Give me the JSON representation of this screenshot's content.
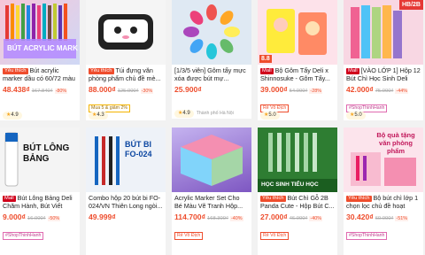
{
  "products": [
    {
      "img_text": "BÚT ACRYLIC MARK",
      "tag": "Yêu thích",
      "title": "Bút acrylic marker dầu có 60/72 màu hộp c...",
      "price": "48.438₫",
      "old": "167.840₫",
      "disc": "-80%",
      "chips": [],
      "rating": "4.9",
      "loc": ""
    },
    {
      "img_text": "",
      "tag": "Yêu thích",
      "title": "Túi đựng văn phòng phẩm chủ đề mè...",
      "price": "88.000₫",
      "old": "125.000₫",
      "disc": "-30%",
      "chips": [
        "Mua 5 & giảm 2%"
      ],
      "rating": "4.3",
      "loc": ""
    },
    {
      "img_text": "",
      "tag": "",
      "title": "[1/3/5 viên] Gôm tẩy mực xóa được bút mự...",
      "price": "25.900₫",
      "old": "",
      "disc": "",
      "chips": [],
      "rating": "4.9",
      "loc": "Thành phố Hà Nội"
    },
    {
      "img_text": "",
      "tag": "Mall",
      "title": "Bộ Gôm Tẩy Deli x Shinnosuke - Gôm Tẩy...",
      "price": "39.000₫",
      "old": "54.000₫",
      "disc": "-28%",
      "chips": [
        "Rẻ Vô Địch",
        "8.8"
      ],
      "rating": "5.0",
      "loc": ""
    },
    {
      "img_text": "HB/2B",
      "tag": "Mall",
      "title": "[VÀO LỚP 1] Hộp 12 Bút Chì Học Sinh Deli Thi...",
      "price": "42.000₫",
      "old": "75.000₫",
      "disc": "-44%",
      "chips": [
        "#ShopThinhHanh"
      ],
      "rating": "5.0",
      "loc": ""
    },
    {
      "img_text": "BÚT LÔNG BẢNG",
      "tag": "Mall",
      "title": "Bút Lông Bảng Deli Chăm Hành, Bút Viết Bả...",
      "price": "9.000₫",
      "old": "16.000₫",
      "disc": "-50%",
      "chips": [
        "#ShopThinhHanh"
      ],
      "rating": "",
      "loc": ""
    },
    {
      "img_text": "BÚT BI FO-024",
      "tag": "",
      "title": "Combo hộp 20 bút bi FO-024/VN Thiên Long ngòi...",
      "price": "49.999₫",
      "old": "",
      "disc": "",
      "chips": [],
      "rating": "",
      "loc": ""
    },
    {
      "img_text": "",
      "tag": "",
      "title": "Acrylic Marker Set Cho Bé Màu Vẽ Tranh Hộp...",
      "price": "114.700₫",
      "old": "168.300₫",
      "disc": "-40%",
      "chips": [
        "Rẻ Vô Địch"
      ],
      "rating": "",
      "loc": ""
    },
    {
      "img_text": "HỌC SINH TIỂU HỌC",
      "tag": "Yêu thích",
      "title": "Bút Chì Gỗ 2B Panda Cute - Hộp Bút C...",
      "price": "27.000₫",
      "old": "46.000₫",
      "disc": "-40%",
      "chips": [
        "Rẻ Vô Địch"
      ],
      "rating": "",
      "loc": ""
    },
    {
      "img_text": "Bộ quà tặng văn phòng phẩm",
      "tag": "Yêu thích",
      "title": "Bộ bút chì lớp 1 chọn lọc chủ đề hoạt hìn...",
      "price": "30.420₫",
      "old": "60.000₫",
      "disc": "-51%",
      "chips": [
        "#ShopThinhHanh"
      ],
      "rating": "",
      "loc": ""
    }
  ]
}
